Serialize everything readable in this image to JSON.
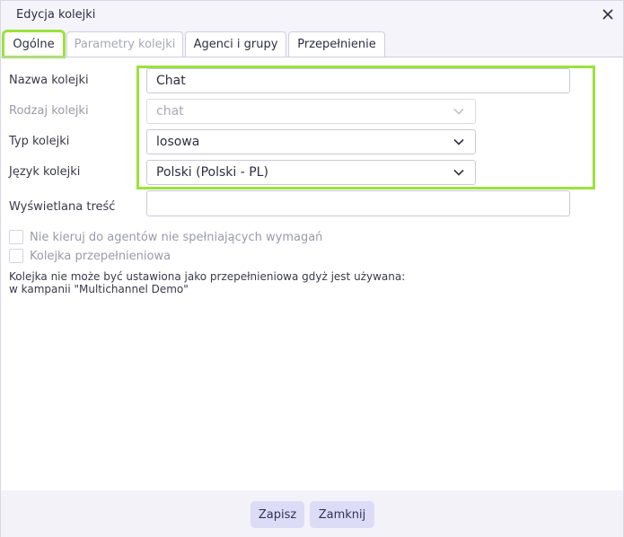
{
  "dialog": {
    "title": "Edycja kolejki"
  },
  "tabs": [
    {
      "label": "Ogólne",
      "state": "active"
    },
    {
      "label": "Parametry kolejki",
      "state": "disabled"
    },
    {
      "label": "Agenci i grupy",
      "state": "normal"
    },
    {
      "label": "Przepełnienie",
      "state": "normal"
    }
  ],
  "form": {
    "queue_name": {
      "label": "Nazwa kolejki",
      "value": "Chat"
    },
    "queue_kind": {
      "label": "Rodzaj kolejki",
      "value": "chat",
      "disabled": true
    },
    "queue_type": {
      "label": "Typ kolejki",
      "value": "losowa"
    },
    "queue_language": {
      "label": "Język kolejki",
      "value": "Polski (Polski - PL)"
    },
    "display_content": {
      "label": "Wyświetlana treść",
      "value": ""
    }
  },
  "checkboxes": [
    {
      "label": "Nie kieruj do agentów nie spełniających wymagań",
      "checked": false,
      "disabled": true
    },
    {
      "label": "Kolejka przepełnieniowa",
      "checked": false,
      "disabled": true
    }
  ],
  "note": {
    "line1": "Kolejka nie może być ustawiona jako przepełnieniowa gdyż jest używana:",
    "line2": "w kampanii \"Multichannel Demo\""
  },
  "footer": {
    "save_label": "Zapisz",
    "close_label": "Zamknij"
  },
  "colors": {
    "highlight": "#9be23c",
    "button_bg": "#dcdcf6",
    "chrome_bg": "#f4f4fa"
  },
  "icons": {
    "close": "close-icon",
    "dropdown": "chevron-down-icon"
  }
}
